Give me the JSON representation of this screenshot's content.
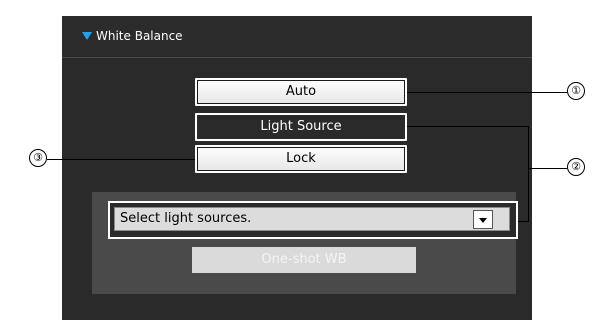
{
  "section": {
    "title": "White Balance",
    "collapse_icon": "triangle-down-icon",
    "accent": "#19a6f0"
  },
  "buttons": {
    "auto_label": "Auto",
    "light_source_label": "Light Source",
    "lock_label": "Lock"
  },
  "light_source_select": {
    "selected": "Select light sources.",
    "dropdown_icon": "chevron-down-icon"
  },
  "oneshot_label": "One-shot WB",
  "callouts": [
    "①",
    "②",
    "③"
  ],
  "colors": {
    "panel_bg": "#2a2a2a",
    "button_bg": "#f4f4f4",
    "disabled_bg": "#dadada"
  }
}
